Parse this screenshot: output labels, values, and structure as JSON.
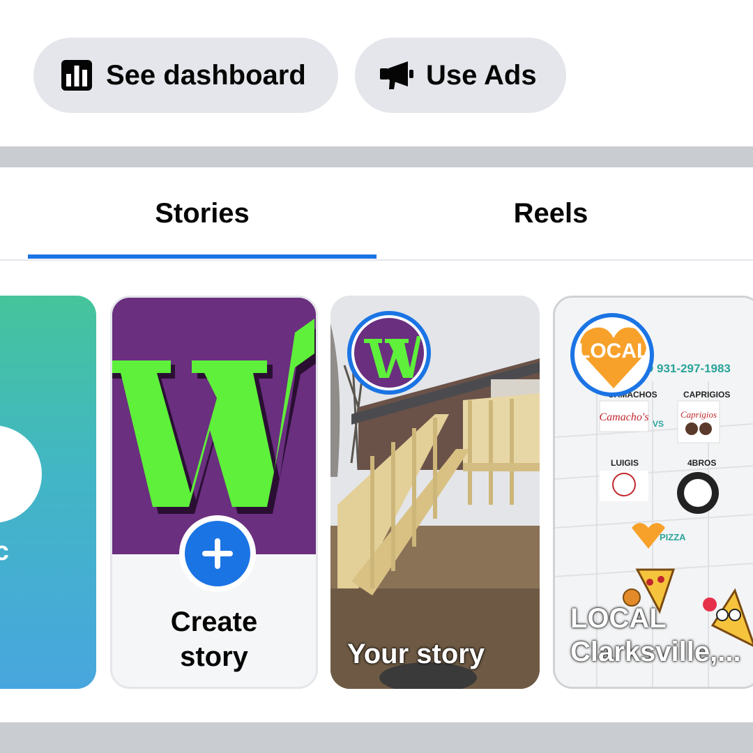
{
  "header": {
    "dashboard_button": {
      "label": "See dashboard",
      "icon": "bar-chart-icon"
    },
    "ads_button": {
      "label": "Use Ads",
      "icon": "megaphone-icon"
    }
  },
  "tabs": [
    {
      "label": "Stories",
      "selected": true
    },
    {
      "label": "Reels",
      "selected": false
    }
  ],
  "stories": {
    "music_card": {
      "label": "sic"
    },
    "create_card": {
      "label_line1": "Create",
      "label_line2": "story",
      "icon": "plus-icon"
    },
    "your_story": {
      "label": "Your story"
    },
    "local_story": {
      "label_line1": "LOCAL",
      "label_line2": "Clarksville,...",
      "avatar_text": "LOCAL",
      "flyer": {
        "phone": "TO 931-297-1983",
        "left_top": "CAMACHOS",
        "right_top": "CAPRIGIOS",
        "left_mid": "LUIGIS",
        "right_mid": "4BROS",
        "vs": "VS",
        "footer": "PIZZA"
      }
    }
  },
  "colors": {
    "accent": "#1b74e4",
    "pill_bg": "#e4e6eb",
    "separator": "#c9ccd1"
  }
}
